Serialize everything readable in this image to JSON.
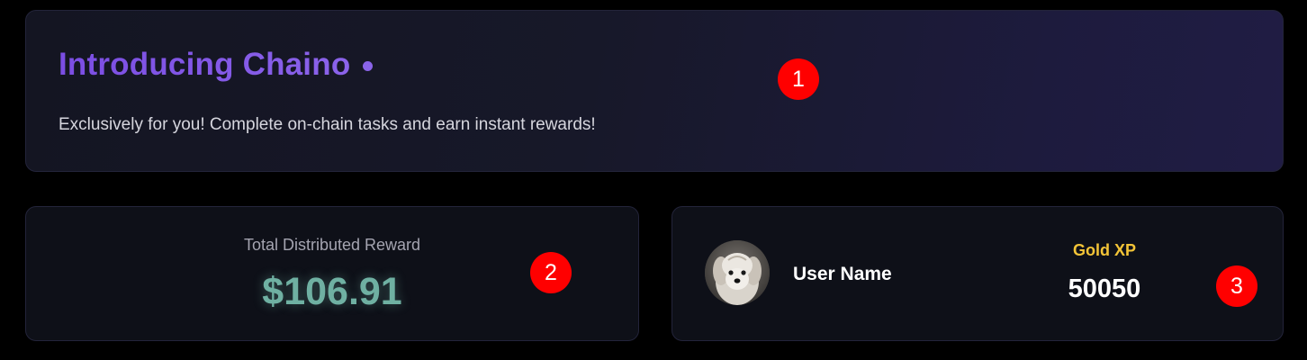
{
  "hero": {
    "title": "Introducing Chaino",
    "subtitle": "Exclusively for you! Complete on-chain tasks and earn instant rewards!"
  },
  "reward_card": {
    "label": "Total Distributed Reward",
    "value": "$106.91"
  },
  "user_card": {
    "avatar_icon": "dog-avatar",
    "user_name": "User Name",
    "xp_label": "Gold XP",
    "xp_value": "50050"
  },
  "annotations": [
    "1",
    "2",
    "3"
  ],
  "colors": {
    "title_purple": "#7f55e6",
    "reward_teal": "#6fb0a2",
    "gold": "#f3c437",
    "badge_red": "#ff0000"
  }
}
